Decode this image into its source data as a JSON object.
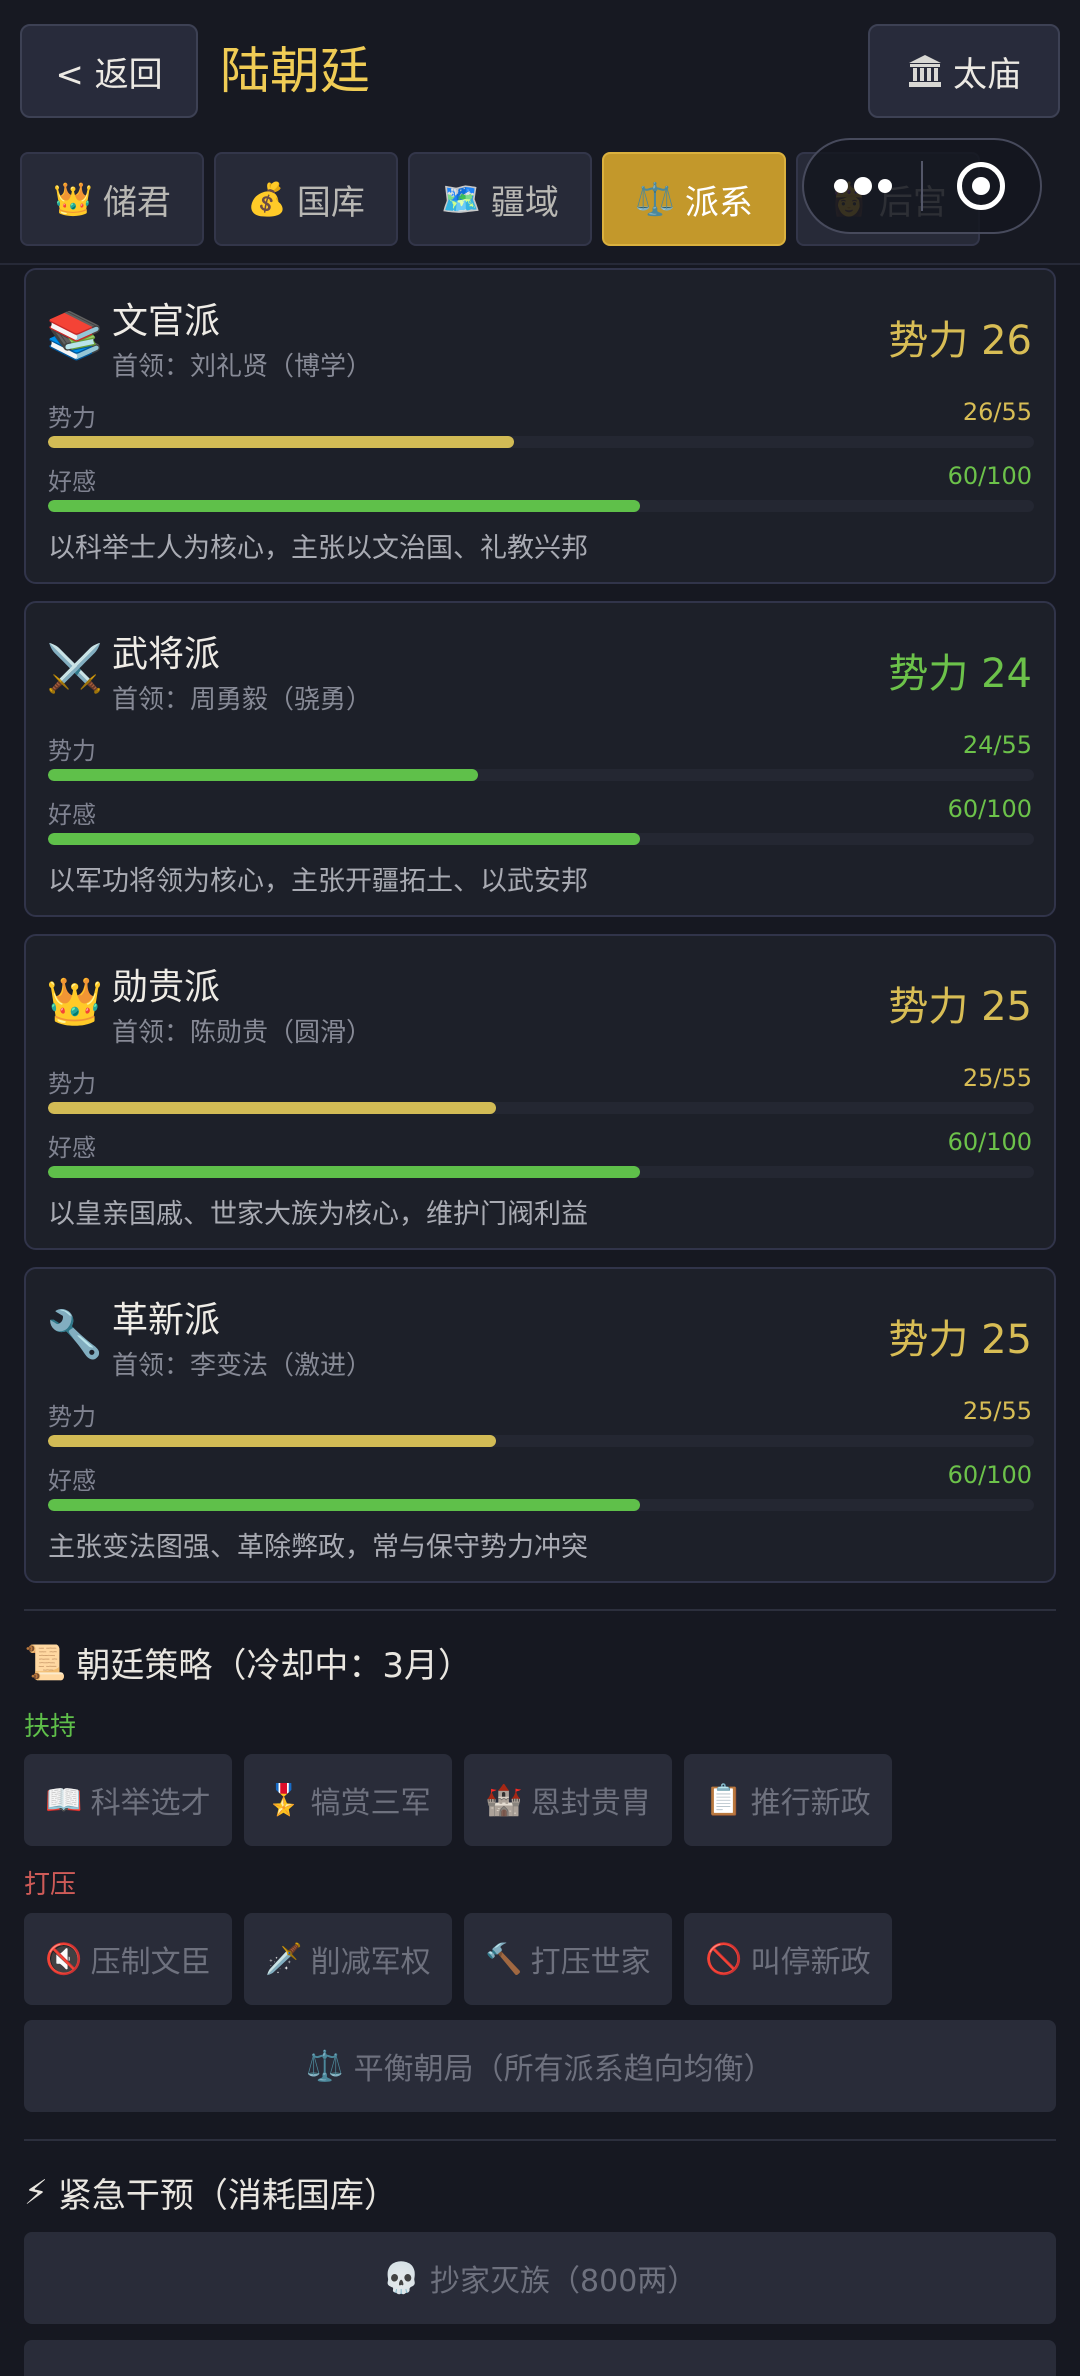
{
  "header": {
    "back_label": "< 返回",
    "title": "陆朝廷",
    "temple_icon": "temple-icon",
    "temple_label": "太庙"
  },
  "tabs": [
    {
      "icon": "👑",
      "label": "储君"
    },
    {
      "icon": "💰",
      "label": "国库"
    },
    {
      "icon": "🗺️",
      "label": "疆域"
    },
    {
      "icon": "⚖️",
      "label": "派系"
    },
    {
      "icon": "👸",
      "label": "后宫"
    }
  ],
  "factions": [
    {
      "icon": "📚",
      "name": "文官派",
      "leader": "首领：刘礼贤（博学）",
      "power_text": "势力 26",
      "power": 26,
      "power_max": 55,
      "power_label": "势力",
      "power_value": "26/55",
      "favor_label": "好感",
      "favor": 60,
      "favor_max": 100,
      "favor_value": "60/100",
      "desc": "以科举士人为核心，主张以文治国、礼教兴邦"
    },
    {
      "icon": "⚔️",
      "name": "武将派",
      "leader": "首领：周勇毅（骁勇）",
      "power_text": "势力 24",
      "power": 24,
      "power_max": 55,
      "power_label": "势力",
      "power_value": "24/55",
      "favor_label": "好感",
      "favor": 60,
      "favor_max": 100,
      "favor_value": "60/100",
      "desc": "以军功将领为核心，主张开疆拓土、以武安邦"
    },
    {
      "icon": "👑",
      "name": "勋贵派",
      "leader": "首领：陈勋贵（圆滑）",
      "power_text": "势力 25",
      "power": 25,
      "power_max": 55,
      "power_label": "势力",
      "power_value": "25/55",
      "favor_label": "好感",
      "favor": 60,
      "favor_max": 100,
      "favor_value": "60/100",
      "desc": "以皇亲国戚、世家大族为核心，维护门阀利益"
    },
    {
      "icon": "🔧",
      "name": "革新派",
      "leader": "首领：李变法（激进）",
      "power_text": "势力 25",
      "power": 25,
      "power_max": 55,
      "power_label": "势力",
      "power_value": "25/55",
      "favor_label": "好感",
      "favor": 60,
      "favor_max": 100,
      "favor_value": "60/100",
      "desc": "主张变法图强、革除弊政，常与保守势力冲突"
    }
  ],
  "strategy": {
    "icon": "📜",
    "title": "朝廷策略（冷却中：3月）",
    "support_label": "扶持",
    "support_buttons": [
      {
        "icon": "📖",
        "label": "科举选才"
      },
      {
        "icon": "🎖️",
        "label": "犒赏三军"
      },
      {
        "icon": "🏰",
        "label": "恩封贵胄"
      },
      {
        "icon": "📋",
        "label": "推行新政"
      }
    ],
    "suppress_label": "打压",
    "suppress_buttons": [
      {
        "icon": "🔇",
        "label": "压制文臣"
      },
      {
        "icon": "🗡️",
        "label": "削减军权"
      },
      {
        "icon": "🔨",
        "label": "打压世家"
      },
      {
        "icon": "🚫",
        "label": "叫停新政"
      }
    ],
    "balance_icon": "⚖️",
    "balance_label": "平衡朝局（所有派系趋向均衡）"
  },
  "emergency": {
    "icon": "⚡",
    "title": "紧急干预（消耗国库）",
    "buttons": [
      {
        "icon": "💀",
        "label": "抄家灭族（800两）"
      }
    ]
  },
  "colors": {
    "accent_gold": "#f0cc55",
    "power_gold": "#d2bb55",
    "power_green": "#6cc24a",
    "favor_green": "#5fc04a",
    "active_tab": "#c3982b"
  }
}
